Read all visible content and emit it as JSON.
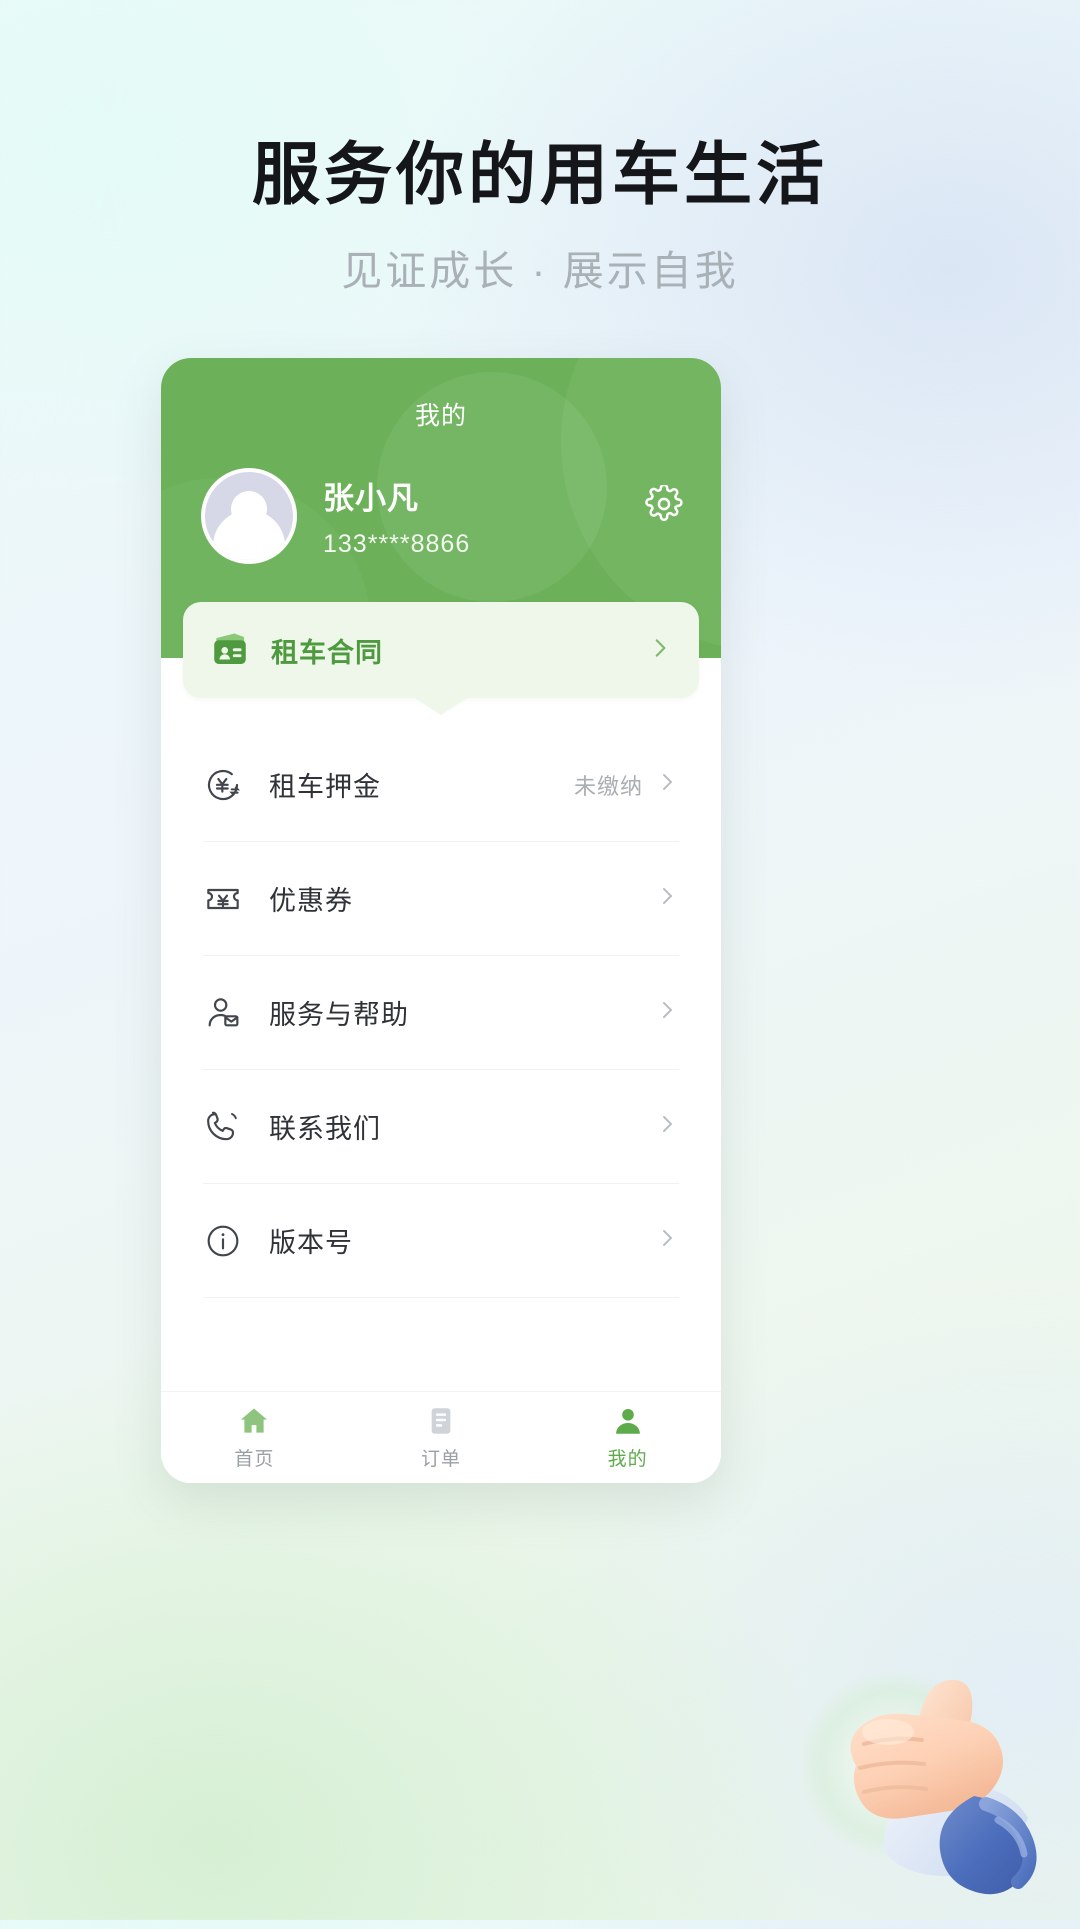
{
  "promo": {
    "headline": "服务你的用车生活",
    "subheadline": "见证成长 · 展示自我"
  },
  "colors": {
    "brand_green": "#6cb159",
    "accent_green": "#4e9a3f",
    "card_green": "#eef7ea",
    "text_dark": "#2f3338",
    "text_muted": "#a9aeb3",
    "headline_black": "#15161a",
    "subhead_gray": "#a9b0b6"
  },
  "app": {
    "nav_title": "我的",
    "settings_icon": "gear-icon",
    "profile": {
      "avatar_icon": "user-avatar-icon",
      "name": "张小凡",
      "phone": "133****8866"
    },
    "contract_card": {
      "icon": "contract-card-icon",
      "label": "租车合同",
      "arrow": "chevron-right-icon"
    },
    "menu_items": [
      {
        "icon": "yen-circle-icon",
        "label": "租车押金",
        "status": "未缴纳",
        "arrow": "chevron-right-icon"
      },
      {
        "icon": "coupon-ticket-icon",
        "label": "优惠券",
        "status": "",
        "arrow": "chevron-right-icon"
      },
      {
        "icon": "person-mail-icon",
        "label": "服务与帮助",
        "status": "",
        "arrow": "chevron-right-icon"
      },
      {
        "icon": "phone-call-icon",
        "label": "联系我们",
        "status": "",
        "arrow": "chevron-right-icon"
      },
      {
        "icon": "info-circle-icon",
        "label": "版本号",
        "status": "",
        "arrow": "chevron-right-icon"
      }
    ],
    "tabs": [
      {
        "icon": "home-icon",
        "label": "首页",
        "active": false
      },
      {
        "icon": "order-icon",
        "label": "订单",
        "active": false
      },
      {
        "icon": "mine-icon",
        "label": "我的",
        "active": true
      }
    ]
  },
  "decoration": {
    "hand_illustration": "thumbs-up-hand-icon"
  }
}
